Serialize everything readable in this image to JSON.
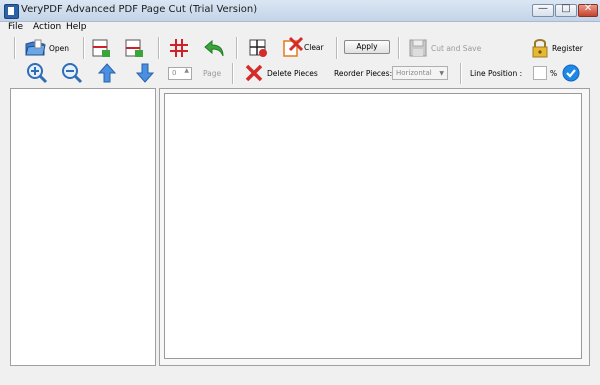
{
  "window": {
    "title": "VeryPDF Advanced PDF Page Cut (Trial Version)",
    "minimize_glyph": "—",
    "maximize_glyph": "□",
    "close_glyph": "✕"
  },
  "menu": {
    "items": [
      "File",
      "Action",
      "Help"
    ]
  },
  "toolbar1": {
    "open_label": "Open",
    "clear_label": "Clear",
    "apply_label": "Apply",
    "cut_save_label": "Cut and Save",
    "register_label": "Register"
  },
  "toolbar2": {
    "page_value": "0",
    "page_label": "Page",
    "delete_pieces_label": "Delete Pieces",
    "reorder_label": "Reorder Pieces:",
    "reorder_value": "Horizontal",
    "line_position_label": "Line Position :",
    "line_position_value": "",
    "percent_label": "%"
  },
  "colors": {
    "accent_blue": "#2f7fd6",
    "grid_red": "#d0202a",
    "undo_green": "#3aa53a",
    "delete_red": "#d42b2b",
    "check_blue": "#1e88e5"
  }
}
